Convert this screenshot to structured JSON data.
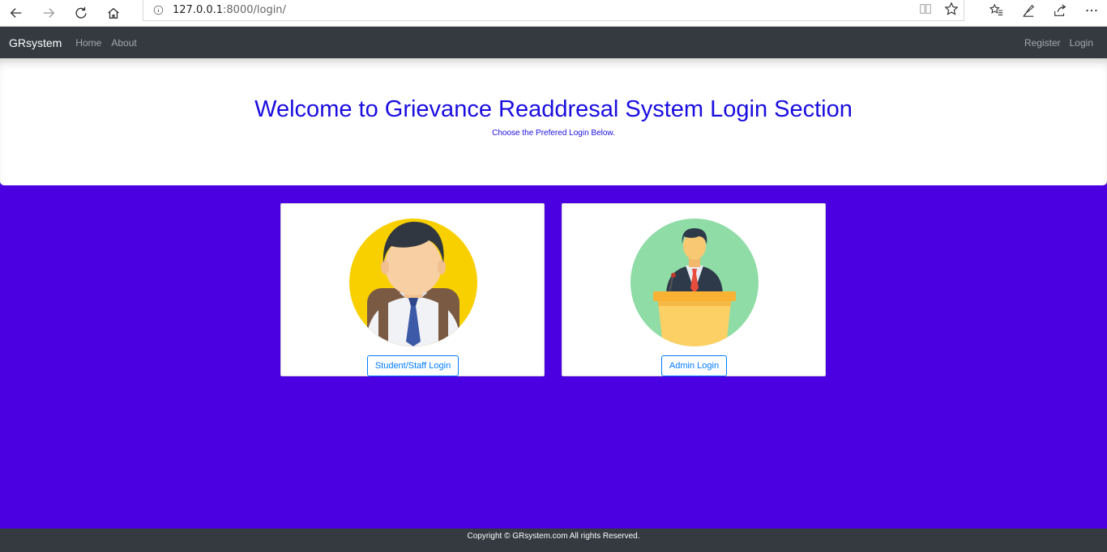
{
  "browser": {
    "url_host": "127.0.0.1",
    "url_rest": ":8000/login/"
  },
  "navbar": {
    "brand": "GRsystem",
    "links": [
      "Home",
      "About"
    ],
    "right_links": [
      "Register",
      "Login"
    ]
  },
  "jumbotron": {
    "title": "Welcome to Grievance Readdresal System Login Section",
    "subtitle": "Choose the Prefered Login Below."
  },
  "cards": [
    {
      "button": "Student/Staff Login",
      "icon": "student-avatar"
    },
    {
      "button": "Admin Login",
      "icon": "speaker-at-podium"
    }
  ],
  "footer": {
    "text": "Copyright © GRsystem.com All rights Reserved."
  },
  "colors": {
    "page_bg": "#4a00e0",
    "navbar_bg": "#343a40",
    "title": "#1a0de0",
    "primary": "#007bff"
  }
}
